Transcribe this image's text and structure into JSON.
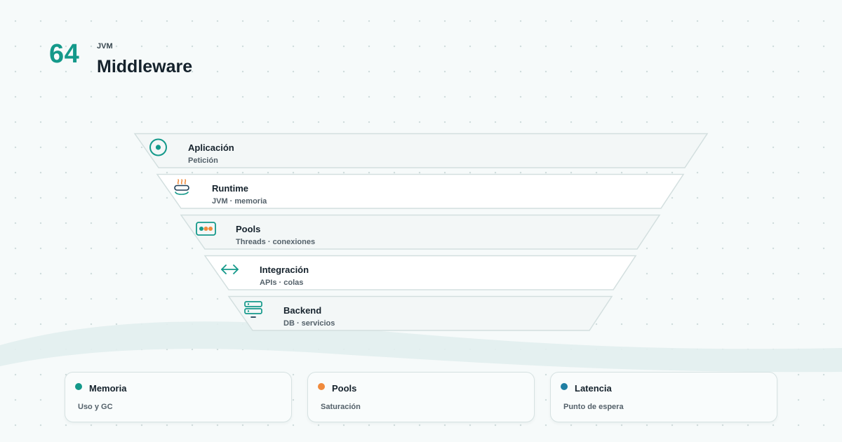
{
  "header": {
    "number": "64",
    "kicker": "JVM",
    "title": "Middleware"
  },
  "layers": [
    {
      "label": "Aplicación",
      "sub": "Petición",
      "icon": "target-icon"
    },
    {
      "label": "Runtime",
      "sub": "JVM · memoria",
      "icon": "coffee-cup-icon"
    },
    {
      "label": "Pools",
      "sub": "Threads · conexiones",
      "icon": "pool-dots-icon"
    },
    {
      "label": "Integración",
      "sub": "APIs · colas",
      "icon": "arrows-left-right-icon"
    },
    {
      "label": "Backend",
      "sub": "DB · servicios",
      "icon": "server-icon"
    }
  ],
  "cards": [
    {
      "title": "Memoria",
      "sub": "Uso y GC",
      "color": "#14998a"
    },
    {
      "title": "Pools",
      "sub": "Saturación",
      "color": "#f08a3c"
    },
    {
      "title": "Latencia",
      "sub": "Punto de espera",
      "color": "#1f7fa3"
    }
  ],
  "colors": {
    "accent": "#14998a",
    "orange": "#f08a3c",
    "blue": "#1f7fa3"
  }
}
